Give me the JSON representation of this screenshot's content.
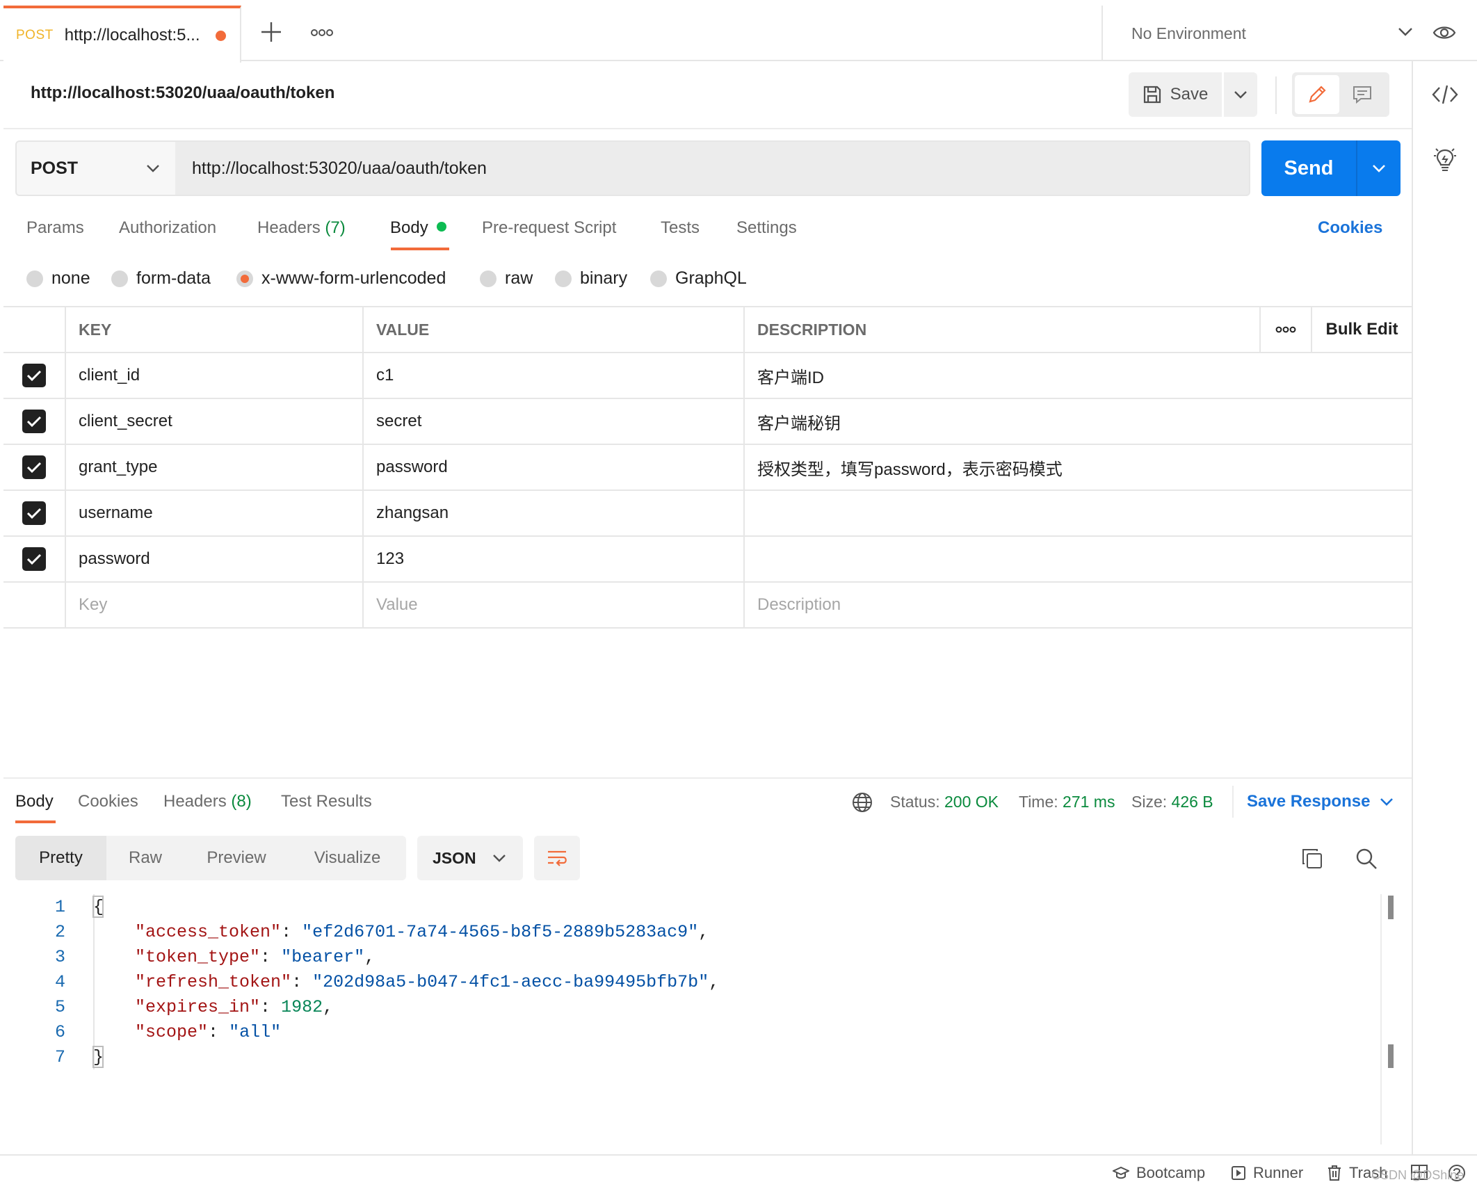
{
  "tab": {
    "method": "POST",
    "title": "http://localhost:5...",
    "unsaved": true
  },
  "environment": {
    "selected": "No Environment"
  },
  "request": {
    "name": "http://localhost:53020/uaa/oauth/token",
    "method": "POST",
    "url": "http://localhost:53020/uaa/oauth/token",
    "save_label": "Save",
    "send_label": "Send"
  },
  "request_tabs": {
    "params": "Params",
    "authorization": "Authorization",
    "headers": "Headers",
    "headers_count": "(7)",
    "body": "Body",
    "prerequest": "Pre-request Script",
    "tests": "Tests",
    "settings": "Settings",
    "cookies": "Cookies"
  },
  "body_types": {
    "none": "none",
    "form_data": "form-data",
    "urlencoded": "x-www-form-urlencoded",
    "raw": "raw",
    "binary": "binary",
    "graphql": "GraphQL",
    "selected": "x-www-form-urlencoded"
  },
  "table": {
    "headers": {
      "key": "KEY",
      "value": "VALUE",
      "description": "DESCRIPTION",
      "bulk_edit": "Bulk Edit"
    },
    "rows": [
      {
        "checked": true,
        "key": "client_id",
        "value": "c1",
        "description": "客户端ID"
      },
      {
        "checked": true,
        "key": "client_secret",
        "value": "secret",
        "description": "客户端秘钥"
      },
      {
        "checked": true,
        "key": "grant_type",
        "value": "password",
        "description": "授权类型，填写password，表示密码模式"
      },
      {
        "checked": true,
        "key": "username",
        "value": "zhangsan",
        "description": ""
      },
      {
        "checked": true,
        "key": "password",
        "value": "123",
        "description": ""
      }
    ],
    "placeholders": {
      "key": "Key",
      "value": "Value",
      "description": "Description"
    }
  },
  "response": {
    "tabs": {
      "body": "Body",
      "cookies": "Cookies",
      "headers": "Headers",
      "headers_count": "(8)",
      "test_results": "Test Results"
    },
    "status_label": "Status:",
    "status_value": "200 OK",
    "time_label": "Time:",
    "time_value": "271 ms",
    "size_label": "Size:",
    "size_value": "426 B",
    "save_response": "Save Response",
    "views": {
      "pretty": "Pretty",
      "raw": "Raw",
      "preview": "Preview",
      "visualize": "Visualize"
    },
    "format": "JSON",
    "line_numbers": [
      "1",
      "2",
      "3",
      "4",
      "5",
      "6",
      "7"
    ],
    "json": {
      "access_token": "ef2d6701-7a74-4565-b8f5-2889b5283ac9",
      "token_type": "bearer",
      "refresh_token": "202d98a5-b047-4fc1-aecc-ba99495bfb7b",
      "expires_in": "1982",
      "scope": "all"
    }
  },
  "statusbar": {
    "bootcamp": "Bootcamp",
    "runner": "Runner",
    "trash": "Trash",
    "watermark": "CSDN @DShine"
  },
  "colors": {
    "accent_orange": "#f26b3a",
    "send_blue": "#097bed",
    "link_blue": "#1a73d9",
    "status_green": "#0a8a3d"
  }
}
